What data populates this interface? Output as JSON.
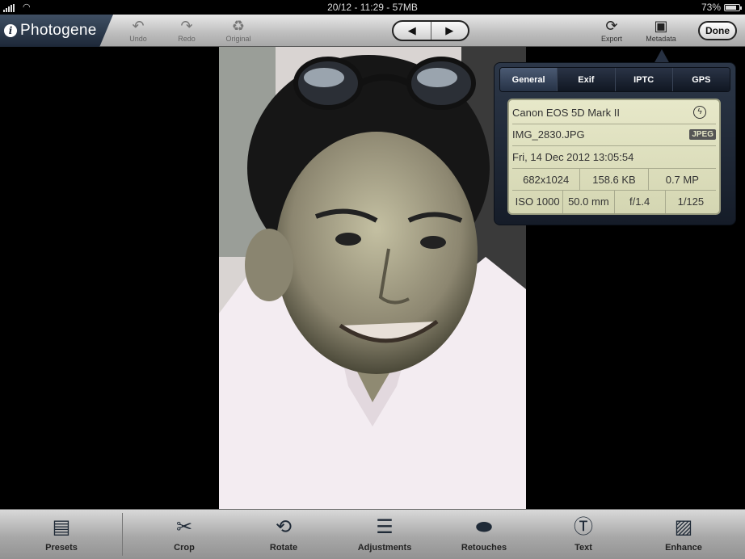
{
  "status": {
    "time": "20/12 - 11:29 - 57MB",
    "battery": "73%",
    "battery_level": 0.73
  },
  "app": {
    "name": "Photogene"
  },
  "toolbar": {
    "undo": "Undo",
    "redo": "Redo",
    "original": "Original",
    "prev_icon": "◀",
    "next_icon": "▶",
    "export": "Export",
    "metadata": "Metadata",
    "done": "Done"
  },
  "metadata": {
    "tabs": [
      "General",
      "Exif",
      "IPTC",
      "GPS"
    ],
    "active_tab": "General",
    "camera": "Canon EOS 5D Mark II",
    "filename": "IMG_2830.JPG",
    "format": "JPEG",
    "date": "Fri, 14 Dec 2012 13:05:54",
    "dimensions": "682x1024",
    "filesize": "158.6 KB",
    "megapixels": "0.7 MP",
    "iso": "ISO 1000",
    "focal": "50.0 mm",
    "aperture": "f/1.4",
    "shutter": "1/125"
  },
  "bottom": {
    "presets": "Presets",
    "crop": "Crop",
    "rotate": "Rotate",
    "adjustments": "Adjustments",
    "retouches": "Retouches",
    "text": "Text",
    "enhance": "Enhance"
  }
}
